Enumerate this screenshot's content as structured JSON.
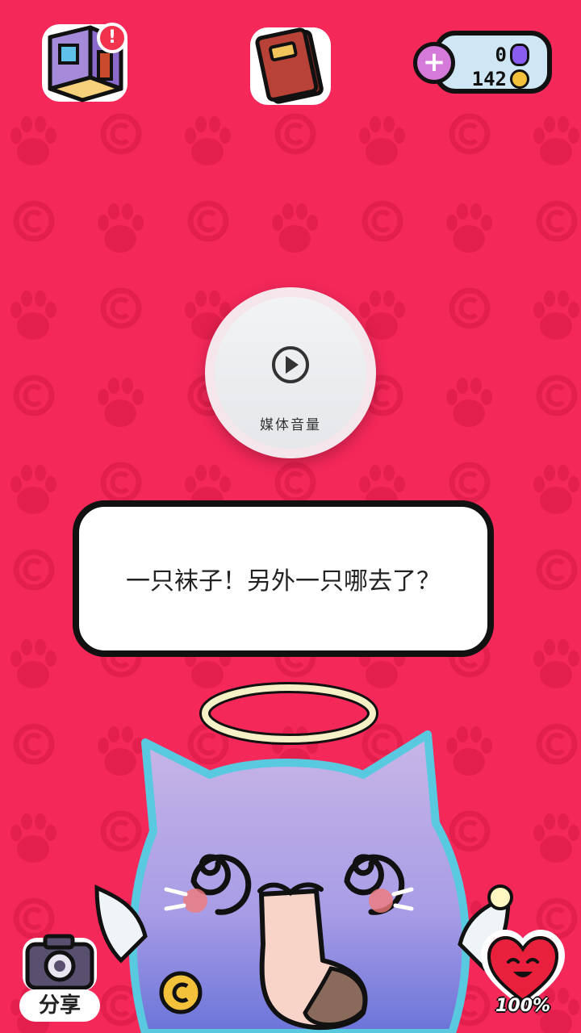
{
  "top_bar": {
    "room_icon": "room-icon",
    "alert_badge": "!",
    "book_icon": "book-icon",
    "currency": {
      "add_label": "+",
      "gems": "0",
      "coins": "142"
    }
  },
  "media_overlay": {
    "icon": "play-icon",
    "label": "媒体音量"
  },
  "dialog": {
    "text": "一只袜子！另外一只哪去了？"
  },
  "bottom": {
    "share_label": "分享",
    "health_percent": "100%"
  },
  "colors": {
    "background": "#f5285a",
    "pattern": "#e31f4d",
    "cat_body": "#b9a9e3",
    "cat_outline": "#59c9e0"
  }
}
